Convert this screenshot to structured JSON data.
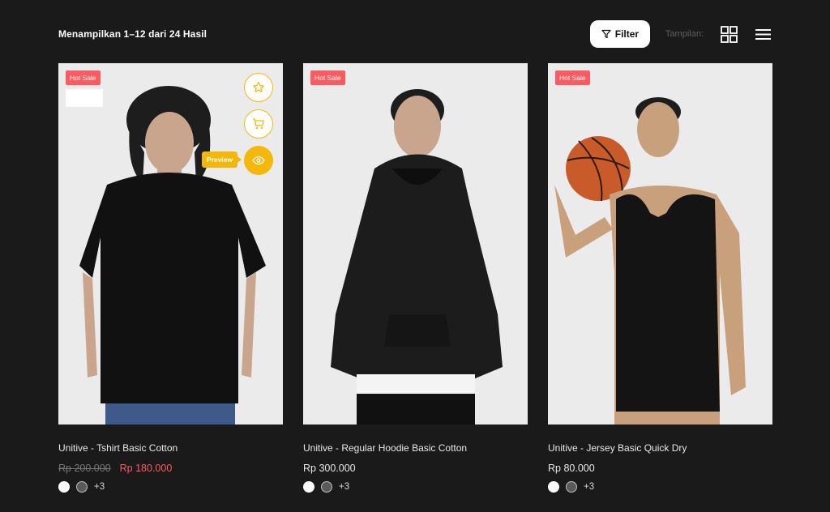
{
  "header": {
    "result_text": "Menampilkan 1–12 dari 24 Hasil",
    "filter_label": "Filter",
    "view_label": "Tampilan:"
  },
  "colors": {
    "background": "#1a1a1a",
    "badge": "#ff5a5f",
    "accent": "#f5b80a",
    "sale_price": "#ff5a5f"
  },
  "actions": {
    "preview_tooltip": "Preview",
    "icons": [
      "star-icon",
      "cart-icon",
      "eye-icon"
    ]
  },
  "products": [
    {
      "badge": "Hot Sale",
      "name": "Unitive - Tshirt Basic Cotton",
      "price_old": "Rp 200.000",
      "price": "Rp 180.000",
      "more_colors": "+3"
    },
    {
      "badge": "Hot Sale",
      "name": "Unitive - Regular Hoodie Basic Cotton",
      "price": "Rp 300.000",
      "more_colors": "+3"
    },
    {
      "badge": "Hot Sale",
      "name": "Unitive - Jersey Basic Quick Dry",
      "price": "Rp 80.000",
      "more_colors": "+3"
    }
  ]
}
